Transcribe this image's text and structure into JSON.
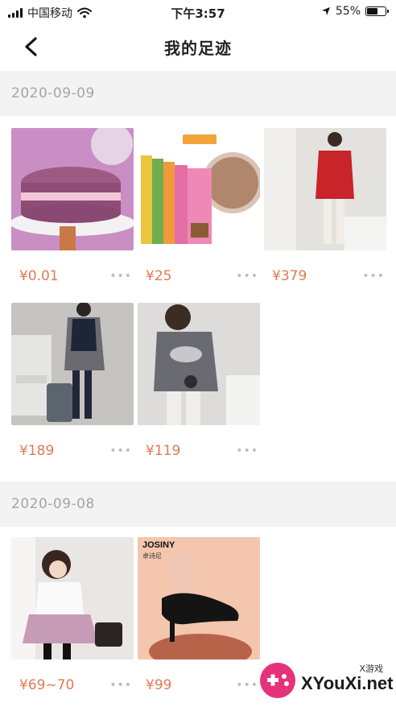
{
  "status_bar": {
    "carrier": "中国移动",
    "time": "下午3:57",
    "battery_pct": "55%",
    "battery_level": 0.55
  },
  "nav": {
    "title": "我的足迹",
    "back_icon": "chevron-left-icon"
  },
  "sections": [
    {
      "date": "2020-09-09",
      "items": [
        {
          "price": "¥0.01",
          "image": "purple-cake"
        },
        {
          "price": "¥25",
          "image": "snack-bags"
        },
        {
          "price": "¥379",
          "image": "red-jacket-woman"
        },
        {
          "price": "¥189",
          "image": "vest-outfit-woman"
        },
        {
          "price": "¥119",
          "image": "ucla-hoodie-woman"
        }
      ]
    },
    {
      "date": "2020-09-08",
      "items": [
        {
          "price": "¥69~70",
          "image": "school-uniform-girl"
        },
        {
          "price": "¥99",
          "image": "black-heel-shoe",
          "brand": "JOSINY",
          "brand_sub": "卓诗尼"
        }
      ]
    }
  ],
  "more_label": "•••",
  "watermark": {
    "text": "XYouXi.net",
    "small": "X游戏"
  },
  "colors": {
    "price": "#e07a55",
    "header_bg": "#f3f3f3",
    "date_text": "#a5a5a5"
  }
}
